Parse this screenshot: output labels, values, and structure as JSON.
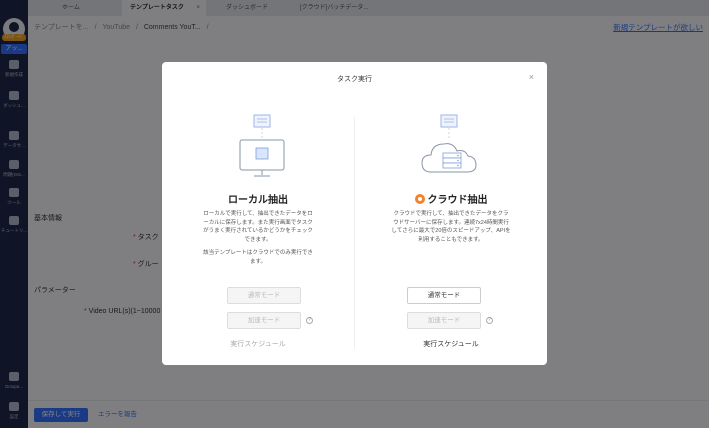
{
  "tabs": [
    {
      "label": "ホーム"
    },
    {
      "label": "テンプレートタスク",
      "close": "×"
    },
    {
      "label": "ダッシュボード"
    },
    {
      "label": "[クラウド]バッチデータ..."
    }
  ],
  "sidebar": {
    "badge": "ｽﾀﾝﾀﾞｰﾄﾞ",
    "account": "アッ...",
    "items": [
      {
        "label": "新規作成",
        "icon": "plus-icon"
      },
      {
        "label": "ダッシュ...",
        "icon": "bookmark-icon"
      },
      {
        "label": "データサ...",
        "icon": "diamond-icon"
      },
      {
        "label": "問題(ISS...",
        "icon": "headset-icon"
      },
      {
        "label": "ツール",
        "icon": "toolbox-icon"
      },
      {
        "label": "チュートリ...",
        "icon": "graduation-cap-icon"
      },
      {
        "label": "Octopa...",
        "icon": "info-icon"
      },
      {
        "label": "設定",
        "icon": "gear-icon"
      }
    ]
  },
  "breadcrumb": [
    "テンプレートを...",
    "/",
    "YouTube",
    "/",
    "Comments YouT...",
    "/"
  ],
  "new_template_link": "新規テンプレートが欲しい",
  "form": {
    "basic_info": "基本情報",
    "task_label": "タスク",
    "group_label": "グルー",
    "parameters": "パラメーター",
    "video_url_label": "Video URL(s)(1~10000"
  },
  "bottom": {
    "save_run": "保存して実行",
    "report_error": "エラーを報告"
  },
  "modal": {
    "title": "タスク実行",
    "close": "×",
    "local": {
      "title": "ローカル抽出",
      "desc": "ローカルで実行して、抽出できたデータをローカルに保存します。また実行画面でタスクがうまく実行されているかどうかをチェックできます。",
      "note": "該当テンプレートはクラウドでのみ実行できます。",
      "normal_mode": "通常モード",
      "speed_mode": "加速モード",
      "help": "?",
      "schedule": "実行スケジュール"
    },
    "cloud": {
      "title": "クラウド抽出",
      "desc": "クラウドで実行して、抽出できたデータをクラウドサーバーに保存します。連続7x24時間実行してさらに最大で20倍のスピードアップ、APIを利用することもできます。",
      "normal_mode": "通常モード",
      "speed_mode": "加速モード",
      "help": "?",
      "schedule": "実行スケジュール"
    }
  },
  "colors": {
    "accent": "#3470ff",
    "sidebar": "#1d2a4a",
    "cloud_badge": "#f5822a"
  }
}
